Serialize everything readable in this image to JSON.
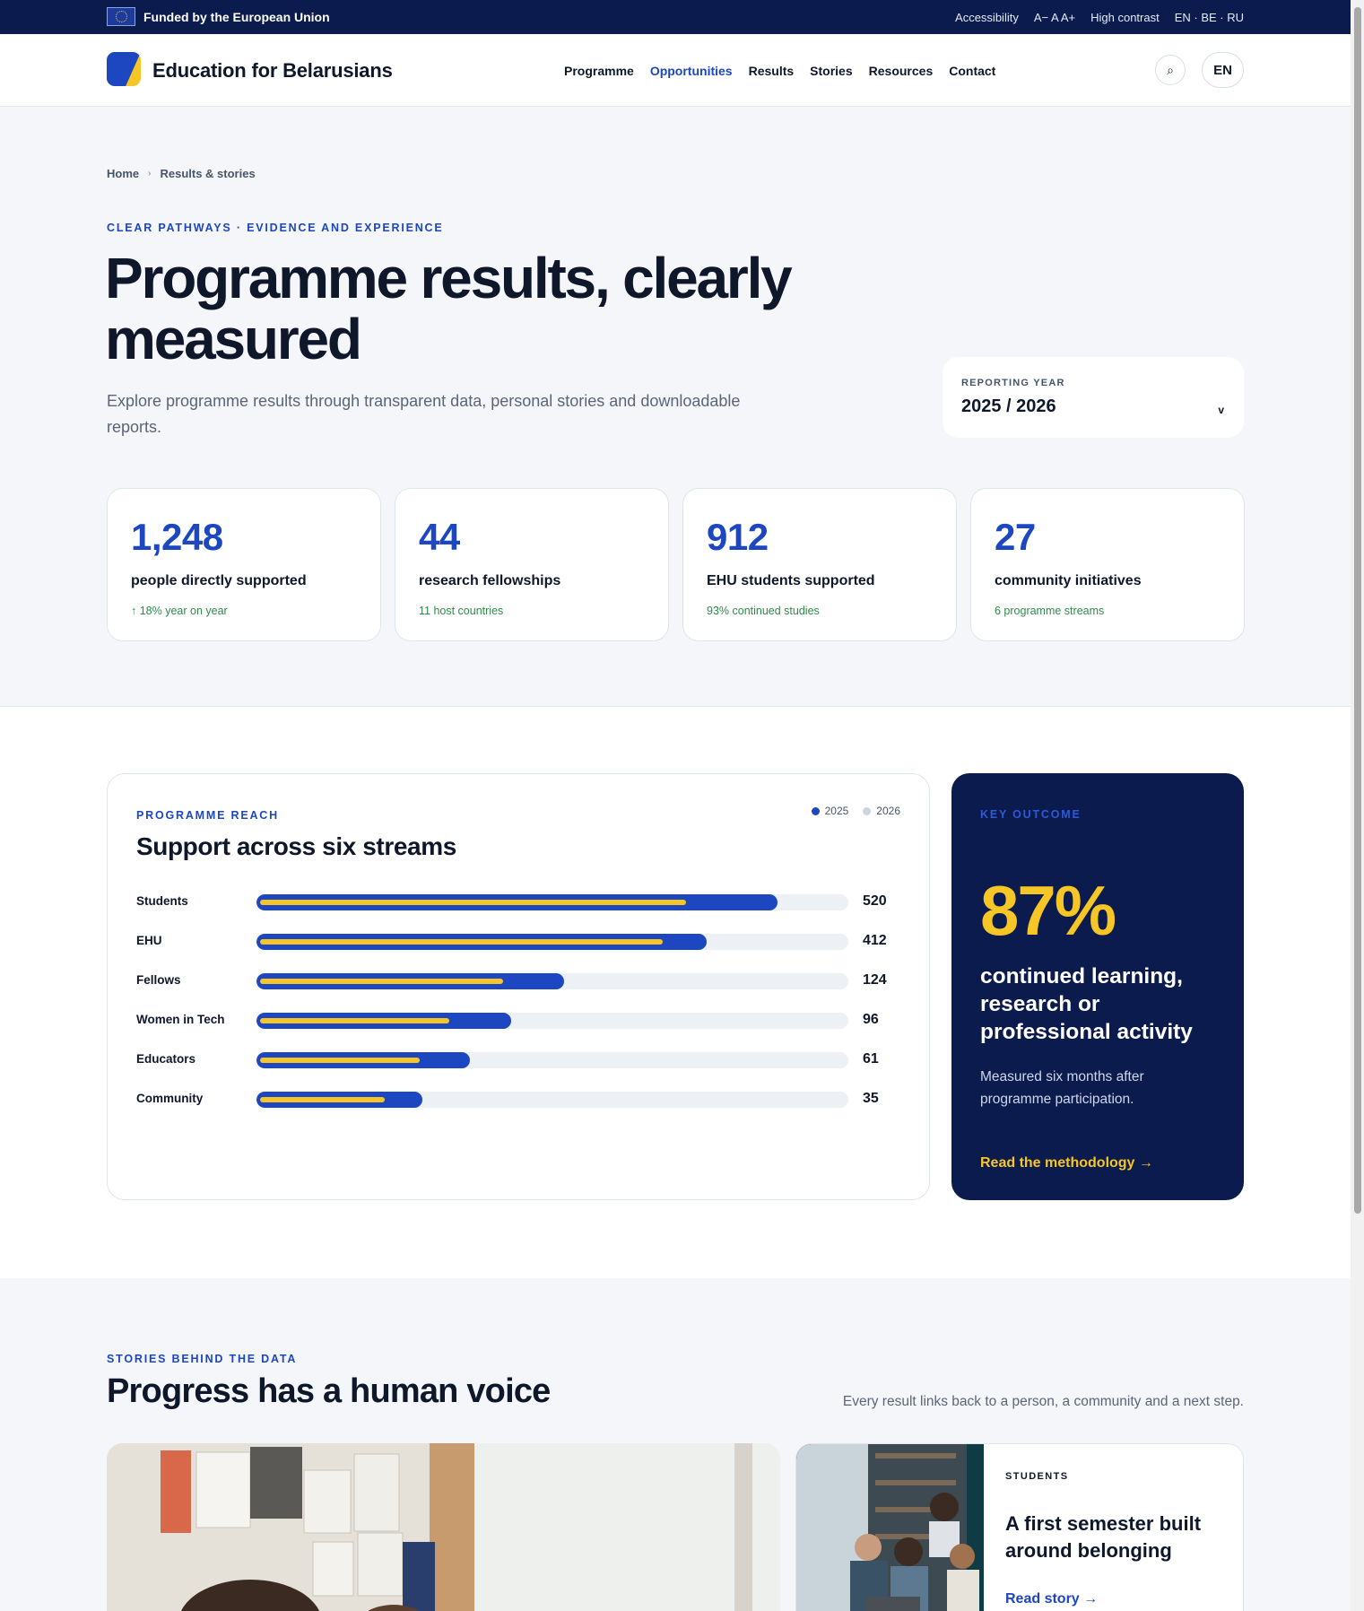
{
  "eu_bar": {
    "funded": "Funded by the European Union",
    "tools": [
      "Accessibility",
      "A− A A+",
      "High contrast",
      "EN · BE · RU"
    ]
  },
  "header": {
    "brand": "Education for Belarusians",
    "nav": [
      {
        "label": "Programme",
        "active": false
      },
      {
        "label": "Opportunities",
        "active": true
      },
      {
        "label": "Results",
        "active": false
      },
      {
        "label": "Stories",
        "active": false
      },
      {
        "label": "Resources",
        "active": false
      },
      {
        "label": "Contact",
        "active": false
      }
    ],
    "search_icon": "⌕",
    "lang": "EN"
  },
  "hero": {
    "breadcrumb": [
      "Home",
      "Results & stories"
    ],
    "breadcrumb_sep": "›",
    "eyebrow": "CLEAR PATHWAYS · EVIDENCE AND EXPERIENCE",
    "title": "Programme results, clearly measured",
    "subtitle": "Explore programme results through transparent data, personal stories and downloadable reports.",
    "year_label": "REPORTING YEAR",
    "year_value": "2025 / 2026",
    "year_chevron": "v"
  },
  "stats": [
    {
      "value": "1,248",
      "label": "people directly supported",
      "note": "↑ 18% year on year"
    },
    {
      "value": "44",
      "label": "research fellowships",
      "note": "11 host countries"
    },
    {
      "value": "912",
      "label": "EHU students supported",
      "note": "93% continued studies"
    },
    {
      "value": "27",
      "label": "community initiatives",
      "note": "6 programme streams"
    }
  ],
  "reach": {
    "eyebrow": "PROGRAMME REACH",
    "title": "Support across six streams",
    "legend": [
      {
        "label": "2025",
        "color": "#1d46c1"
      },
      {
        "label": "2026",
        "color": "#cbd5e1"
      }
    ]
  },
  "chart_data": {
    "type": "bar",
    "orientation": "horizontal",
    "title": "Support across six streams",
    "categories": [
      "Students",
      "EHU",
      "Fellows",
      "Women in Tech",
      "Educators",
      "Community"
    ],
    "value_labels": [
      "520",
      "412",
      "124",
      "96",
      "61",
      "35"
    ],
    "series": [
      {
        "name": "2025",
        "color": "#1d46c1",
        "values": [
          0.88,
          0.76,
          0.52,
          0.43,
          0.36,
          0.28
        ]
      },
      {
        "name": "2026",
        "color": "#f6c627",
        "values": [
          0.72,
          0.68,
          0.41,
          0.32,
          0.27,
          0.21
        ]
      }
    ],
    "value_scale": "fraction of track",
    "legend_position": "top-right"
  },
  "outcome": {
    "eyebrow": "KEY OUTCOME",
    "value": "87%",
    "headline": "continued learning, research or professional activity",
    "description": "Measured six months after programme participation.",
    "link": "Read the methodology →"
  },
  "stories": {
    "eyebrow": "STORIES BEHIND THE DATA",
    "title": "Progress has a human voice",
    "subtitle": "Every result links back to a person, a community and a next step.",
    "side": {
      "category": "STUDENTS",
      "title": "A first semester built around belonging",
      "link": "Read story →"
    }
  }
}
